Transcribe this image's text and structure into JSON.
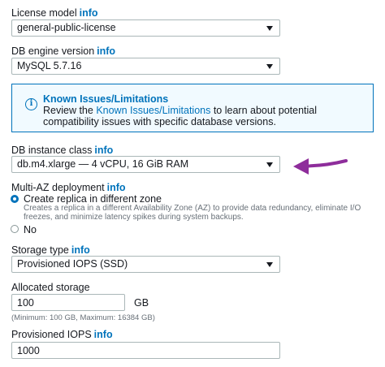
{
  "license_model": {
    "label": "License model",
    "info": "info",
    "value": "general-public-license"
  },
  "engine_version": {
    "label": "DB engine version",
    "info": "info",
    "value": "MySQL 5.7.16"
  },
  "alert": {
    "icon": "info-circle-icon",
    "title": "Known Issues/Limitations",
    "body_prefix": "Review the ",
    "body_link": "Known Issues/Limitations",
    "body_suffix": " to learn about potential compatibility issues with specific database versions."
  },
  "instance_class": {
    "label": "DB instance class",
    "info": "info",
    "value": "db.m4.xlarge — 4 vCPU, 16 GiB RAM",
    "arrow_color": "#8e2d9b"
  },
  "multi_az": {
    "label": "Multi-AZ deployment",
    "info": "info",
    "option_replica": "Create replica in different zone",
    "option_replica_desc": "Creates a replica in a different Availability Zone (AZ) to provide data redundancy, eliminate I/O freezes, and minimize latency spikes during system backups.",
    "option_no": "No",
    "selected": "Create replica in different zone"
  },
  "storage_type": {
    "label": "Storage type",
    "info": "info",
    "value": "Provisioned IOPS (SSD)"
  },
  "allocated_storage": {
    "label": "Allocated storage",
    "value": "100",
    "unit": "GB",
    "hint": "(Minimum: 100 GB, Maximum: 16384 GB)"
  },
  "provisioned_iops": {
    "label": "Provisioned IOPS",
    "info": "info",
    "value": "1000"
  },
  "colors": {
    "link": "#0073bb",
    "alert_bg": "#f1faff",
    "annotation_arrow": "#8e2d9b"
  }
}
